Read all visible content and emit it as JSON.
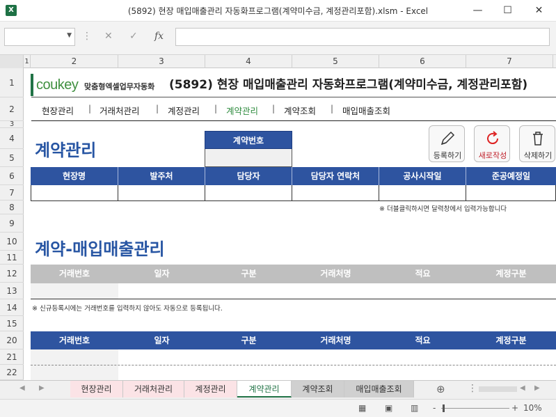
{
  "window": {
    "app_icon": "X",
    "title": "(5892) 현장 매입매출관리 자동화프로그램(계약미수금, 계정관리포함).xlsm - Excel",
    "min": "—",
    "max": "☐",
    "close": "✕"
  },
  "formula": {
    "cancel": "✕",
    "enter": "✓",
    "fx": "fx"
  },
  "columns": [
    "2",
    "3",
    "4",
    "5",
    "6",
    "7"
  ],
  "first_col": "1",
  "rows": [
    "1",
    "2",
    "3",
    "4",
    "5",
    "6",
    "7",
    "8",
    "9",
    "10",
    "11",
    "12",
    "13",
    "14",
    "15",
    "20",
    "21",
    "22"
  ],
  "header": {
    "logo": "coukey",
    "logo_sub": "맞춤형엑셀업무자동화",
    "title": "(5892) 현장 매입매출관리 자동화프로그램(계약미수금, 계정관리포함)"
  },
  "nav": [
    "현장관리",
    "거래처관리",
    "계정관리",
    "계약관리",
    "계약조회",
    "매입매출조회"
  ],
  "nav_separator": "|",
  "contract": {
    "heading": "계약관리",
    "number_label": "계약번호",
    "number_value": "",
    "buttons": [
      "등록하기",
      "새로작성",
      "삭제하기"
    ],
    "columns": [
      "현장명",
      "발주처",
      "담당자",
      "담당자 연락처",
      "공사시작일",
      "준공예정일"
    ],
    "note": "※ 더블클릭하시면 달력창에서 입력가능합니다"
  },
  "purchase": {
    "heading": "계약-매입매출관리",
    "columns": [
      "거래번호",
      "일자",
      "구분",
      "거래처명",
      "적요",
      "계정구분"
    ],
    "note": "※ 신규등록시에는 거래번호를 입력하지 않아도 자동으로 등록됩니다.",
    "columns2": [
      "거래번호",
      "일자",
      "구분",
      "거래처명",
      "적요",
      "계정구분"
    ]
  },
  "tabs": [
    "현장관리",
    "거래처관리",
    "계정관리",
    "계약관리",
    "계약조회",
    "매입매출조회"
  ],
  "active_tab": "계약관리",
  "statusbar": {
    "zoom": "10%",
    "minus": "-",
    "plus": "+"
  },
  "colors": {
    "accent_blue": "#2e54a0",
    "heading_blue": "#2755a3",
    "excel_green": "#217346"
  }
}
